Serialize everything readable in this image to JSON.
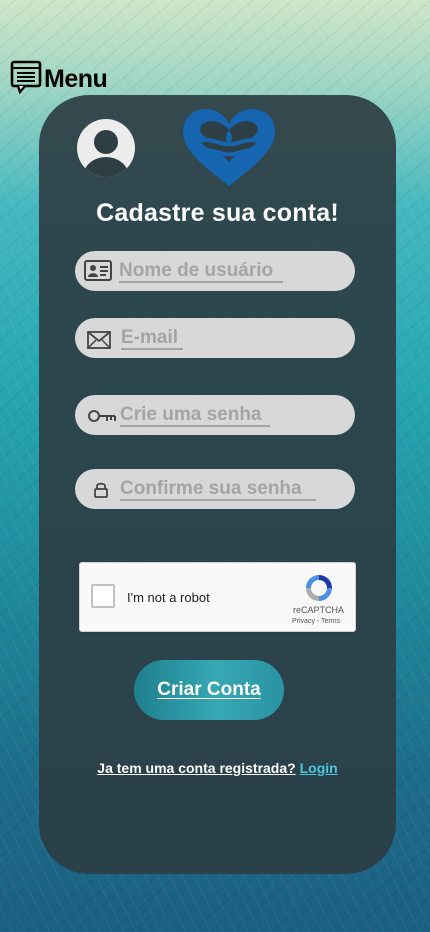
{
  "menu": {
    "label": "Menu",
    "icon": "chat-menu-icon"
  },
  "header": {
    "title": "Cadastre sua conta!"
  },
  "form": {
    "username": {
      "placeholder": "Nome de usuário",
      "value": "",
      "icon": "id-card-icon"
    },
    "email": {
      "placeholder": "E-mail",
      "value": "",
      "icon": "envelope-icon"
    },
    "password": {
      "placeholder": "Crie uma senha",
      "value": "",
      "icon": "key-icon"
    },
    "confirm": {
      "placeholder": "Confirme sua senha",
      "value": "",
      "icon": "lock-icon"
    },
    "submit_label": "Criar Conta"
  },
  "captcha": {
    "label": "I'm not a robot",
    "brand": "reCAPTCHA",
    "links": "Privacy - Terms",
    "checked": false
  },
  "footer": {
    "question": "Ja tem uma conta registrada?",
    "login_label": "Login"
  },
  "colors": {
    "card": "#2d3e44",
    "field": "#d8d8d8",
    "button": "#2a93a4",
    "login_link": "#4cc6e0",
    "logo": "#1565b0"
  }
}
